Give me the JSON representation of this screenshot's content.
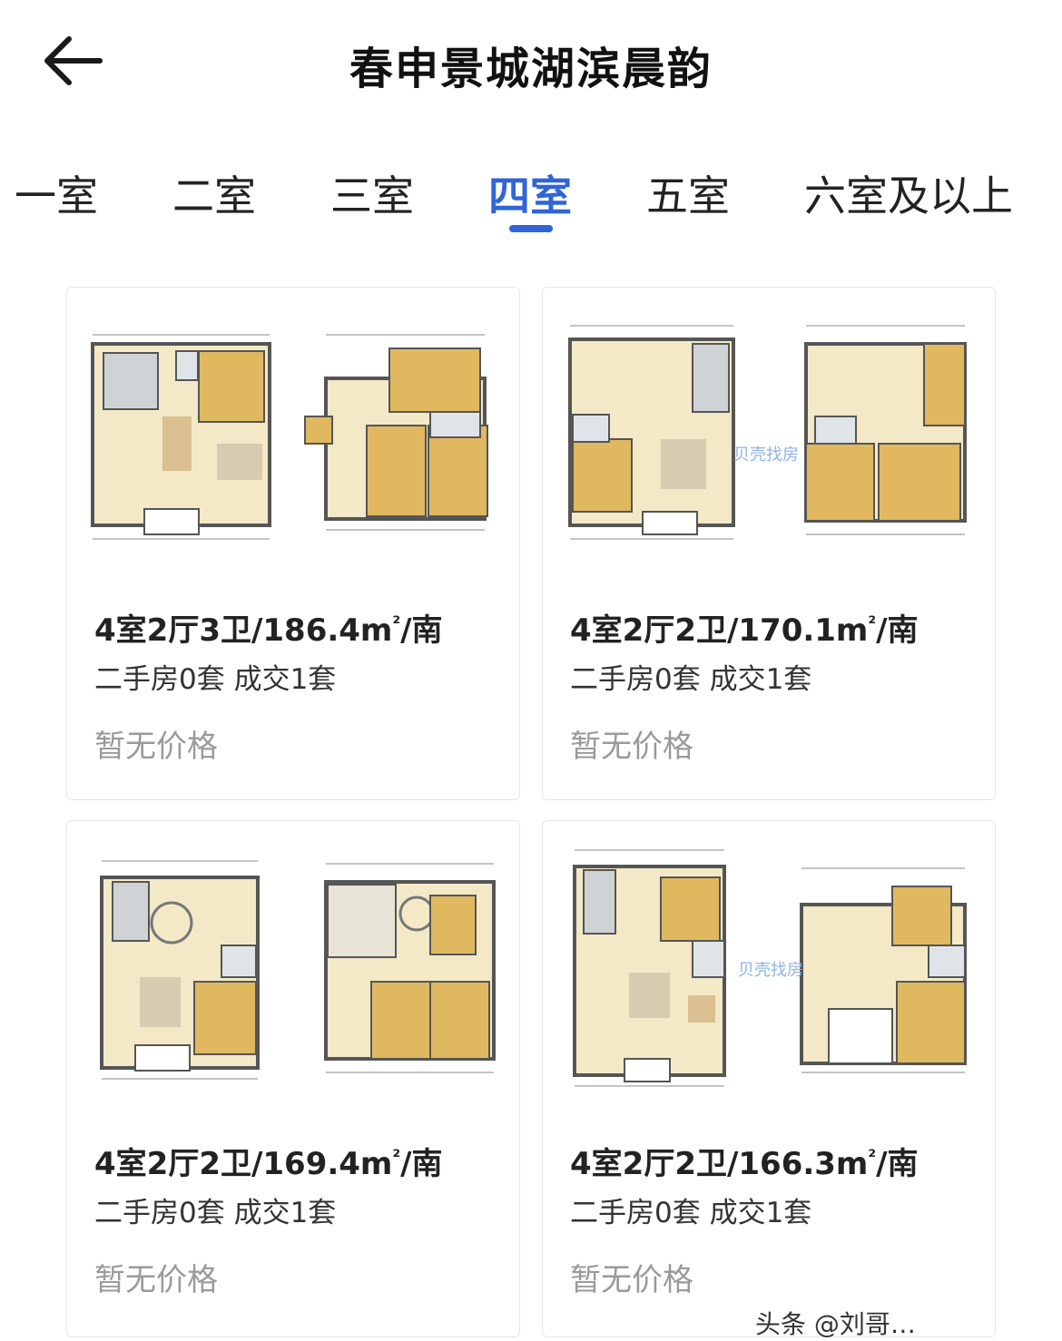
{
  "header": {
    "title": "春申景城湖滨晨韵"
  },
  "tabs": [
    {
      "label": "一室"
    },
    {
      "label": "二室"
    },
    {
      "label": "三室"
    },
    {
      "label": "四室"
    },
    {
      "label": "五室"
    },
    {
      "label": "六室及以上"
    }
  ],
  "active_tab": "四室",
  "cards": [
    {
      "layout": "4室2厅3卫/186.4m",
      "orientation": "/南",
      "stats": "二手房0套 成交1套",
      "price": "暂无价格"
    },
    {
      "layout": "4室2厅2卫/170.1m",
      "orientation": "/南",
      "stats": "二手房0套 成交1套",
      "price": "暂无价格"
    },
    {
      "layout": "4室2厅2卫/169.4m",
      "orientation": "/南",
      "stats": "二手房0套 成交1套",
      "price": "暂无价格"
    },
    {
      "layout": "4室2厅2卫/166.3m",
      "orientation": "/南",
      "stats": "二手房0套 成交1套",
      "price": "暂无价格"
    }
  ],
  "area_unit_sup": "²",
  "watermark": "贝壳找房",
  "footer_text": "头条 @刘哥…"
}
